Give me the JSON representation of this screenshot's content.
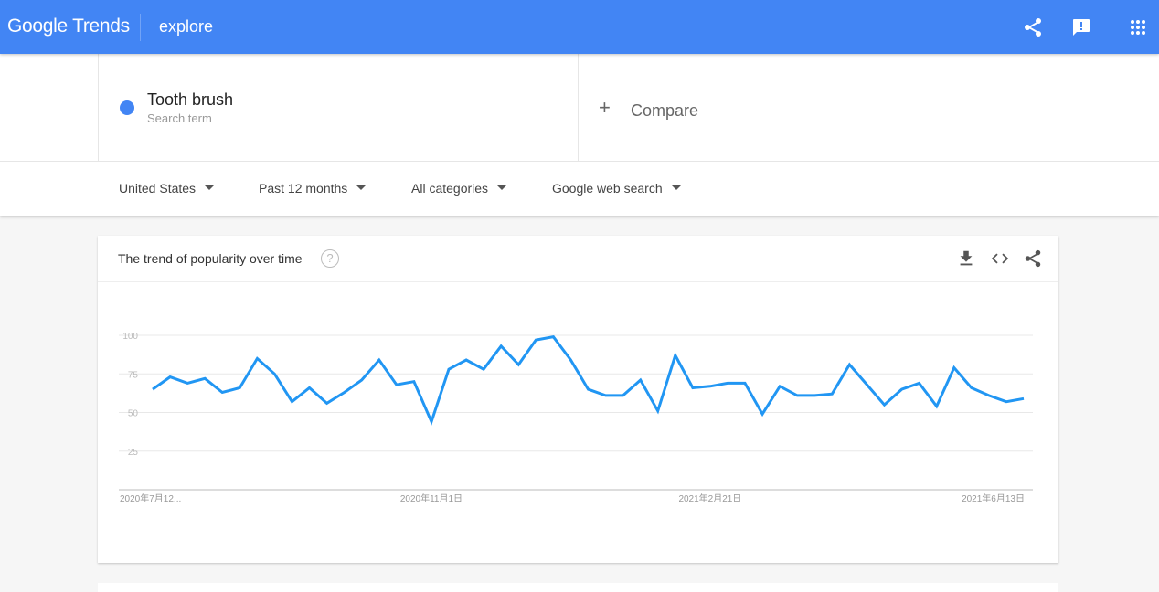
{
  "topbar": {
    "logo": "Google Trends",
    "section": "explore",
    "icons": [
      "share-icon",
      "feedback-icon",
      "apps-grid-icon"
    ]
  },
  "search": {
    "term": "Tooth brush",
    "term_subtitle": "Search term",
    "term_color": "#4285f4",
    "compare_plus": "+",
    "compare_label": "Compare"
  },
  "filters": {
    "region": "United States",
    "time_range": "Past 12 months",
    "category": "All categories",
    "search_type": "Google web search"
  },
  "card": {
    "title": "The trend of popularity over time",
    "help": "?",
    "actions": [
      "download-icon",
      "embed-icon",
      "share-icon"
    ]
  },
  "chart_data": {
    "type": "line",
    "title": "The trend of popularity over time",
    "xlabel": "",
    "ylabel": "",
    "ylim": [
      0,
      100
    ],
    "y_ticks": [
      25,
      50,
      75,
      100
    ],
    "x_tick_labels": [
      "2020年7月12...",
      "2020年11月1日",
      "2021年2月21日",
      "2021年6月13日"
    ],
    "x_tick_indices": [
      0,
      16,
      32,
      48
    ],
    "grid": true,
    "legend": "none",
    "series": [
      {
        "name": "Tooth brush",
        "color": "#2196f3",
        "values": [
          65,
          73,
          69,
          72,
          63,
          66,
          85,
          75,
          57,
          66,
          56,
          63,
          71,
          84,
          68,
          70,
          44,
          78,
          84,
          78,
          93,
          81,
          97,
          99,
          84,
          65,
          61,
          61,
          71,
          51,
          87,
          66,
          67,
          69,
          69,
          49,
          67,
          61,
          61,
          62,
          81,
          68,
          55,
          65,
          69,
          54,
          79,
          66,
          61,
          57,
          59
        ]
      }
    ]
  }
}
